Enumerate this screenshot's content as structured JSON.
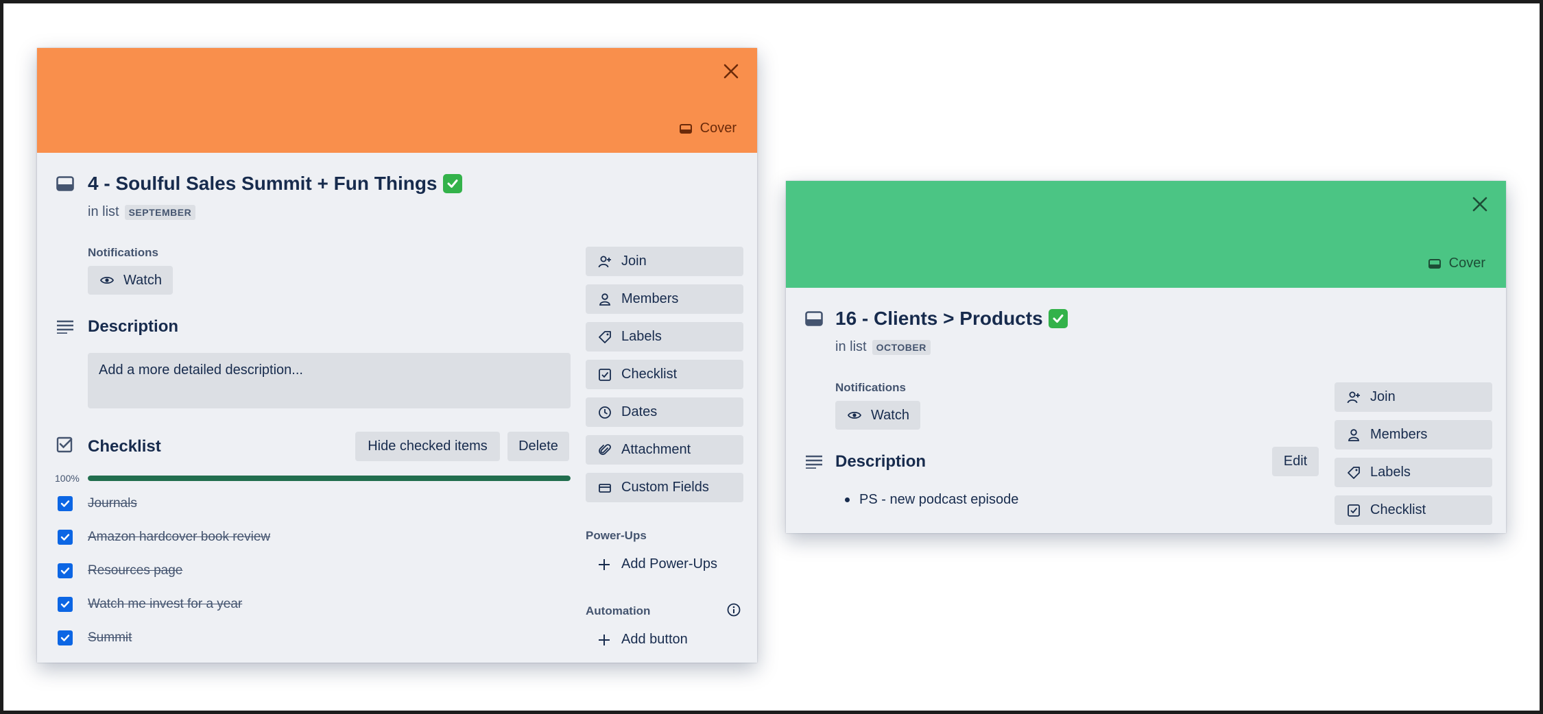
{
  "cards": [
    {
      "cover_color": "#f98f4c",
      "cover_label": "Cover",
      "title": "4 - Soulful Sales Summit + Fun Things",
      "in_list_prefix": "in list",
      "list_name": "SEPTEMBER",
      "notifications_label": "Notifications",
      "watch_label": "Watch",
      "description_title": "Description",
      "description_placeholder": "Add a more detailed description...",
      "checklist_title": "Checklist",
      "hide_checked_label": "Hide checked items",
      "delete_label": "Delete",
      "progress_label": "100%",
      "progress_percent": 100,
      "checklist_items": [
        "Journals",
        "Amazon hardcover book review",
        "Resources page",
        "Watch me invest for a year",
        "Summit"
      ],
      "sidebar_buttons": [
        "Join",
        "Members",
        "Labels",
        "Checklist",
        "Dates",
        "Attachment",
        "Custom Fields"
      ],
      "powerups_label": "Power-Ups",
      "add_powerups_label": "Add Power-Ups",
      "automation_label": "Automation",
      "add_button_label": "Add button"
    },
    {
      "cover_color": "#4bc584",
      "cover_label": "Cover",
      "title": "16 - Clients > Products",
      "in_list_prefix": "in list",
      "list_name": "OCTOBER",
      "notifications_label": "Notifications",
      "watch_label": "Watch",
      "description_title": "Description",
      "edit_label": "Edit",
      "description_items": [
        "PS - new podcast episode"
      ],
      "sidebar_buttons": [
        "Join",
        "Members",
        "Labels",
        "Checklist"
      ]
    }
  ],
  "colors": {
    "accent_blue": "#0c66e4",
    "progress_green": "#216e4e",
    "emoji_check_green": "#33b24a",
    "panel_bg": "#eef0f4"
  }
}
